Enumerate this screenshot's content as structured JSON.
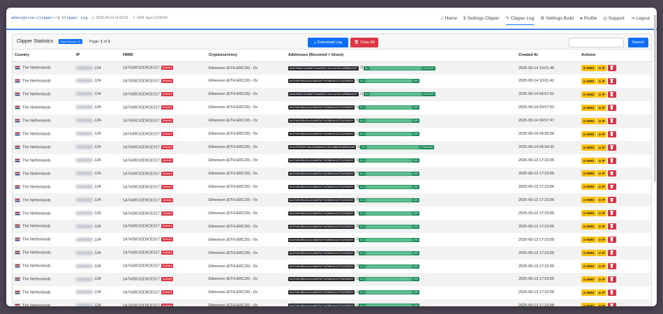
{
  "topbar": {
    "term_user": "admin@crow-clipper",
    "term_sep": ":~$",
    "term_page": "Clipper Log",
    "datetime": "2026-09-14 11:00:21",
    "uptime": "1941 days 12:00:00"
  },
  "nav": {
    "items": [
      {
        "label": "Home",
        "icon": "home-icon"
      },
      {
        "label": "Settings Clipper",
        "icon": "dollar-icon"
      },
      {
        "label": "Clipper Log",
        "icon": "pencil-icon",
        "active": true
      },
      {
        "label": "Settings Build",
        "icon": "gear-icon"
      },
      {
        "label": "Profile",
        "icon": "user-icon"
      },
      {
        "label": "Support",
        "icon": "support-icon"
      },
      {
        "label": "Logout",
        "icon": "logout-icon"
      }
    ]
  },
  "header": {
    "title": "Clipper Statistics",
    "total_badge": "Total Records: 32",
    "page_prefix": "Page:",
    "page_current": "1",
    "page_of": "of",
    "page_total": "1",
    "download_label": "Download Log",
    "clear_label": "Clear All",
    "search_placeholder": "",
    "search_label": "Search"
  },
  "table": {
    "columns": [
      "Country",
      "IP",
      "HWID",
      "Cryptocurrency",
      "Addresses (Received > Given)",
      "Created At",
      "Actions"
    ],
    "deleted_label": "Deleted",
    "hwid_btn": "HWID",
    "ip_btn": "IP",
    "rows": [
      {
        "country": "The Netherlands",
        "ip": ".124",
        "hwid": "1A7439C02D9CE017",
        "crypto": "Ethereum (ETH.ERC20) - 0x",
        "recv": "0x0165a8f41b58dff1be0507c7ee1cdf4e1a9988d4137",
        "given_a": "0x",
        "given_b": "e20a137",
        "created": "2025-09-14 10:01:45"
      },
      {
        "country": "The Netherlands",
        "ip": ".124",
        "hwid": "1A7439C02D9CE017",
        "crypto": "Ethereum (ETH.ERC20) - 0x",
        "recv": "0x2fe9c38b15ca14d847bf7e530b3e147334238495",
        "given_a": "0x",
        "given_b": "495",
        "created": "2025-09-14 10:01:41"
      },
      {
        "country": "The Netherlands",
        "ip": ".124",
        "hwid": "1A7439C02D9CE017",
        "crypto": "Ethereum (ETH.ERC20) - 0x",
        "recv": "0x0165a8f41b58dff1be0507c7ee1cdf4e1a9988d4137",
        "given_a": "0x",
        "given_b": "e20a137",
        "created": "2025-09-14 09:57:52"
      },
      {
        "country": "The Netherlands",
        "ip": ".124",
        "hwid": "1A7439C02D9CE017",
        "crypto": "Ethereum (ETH.ERC20) - 0x",
        "recv": "0x2fe9c38b15ca14d847bf7e530b3e147334238495",
        "given_a": "0x",
        "given_b": "495",
        "created": "2025-09-14 09:57:52"
      },
      {
        "country": "The Netherlands",
        "ip": ".124",
        "hwid": "1A7439C02D9CE017",
        "crypto": "Ethereum (ETH.ERC20) - 0x",
        "recv": "0x2fe9c38b15ca14d847bf7e530b3e147334238495",
        "given_a": "0x",
        "given_b": "495",
        "created": "2025-09-14 09:57:47"
      },
      {
        "country": "The Netherlands",
        "ip": ".124",
        "hwid": "1A7439C02D9CE017",
        "crypto": "Ethereum (ETH.ERC20) - 0x",
        "recv": "0x2fe9c38b15ca14d847bf7e530b3e147334238495",
        "given_a": "0x",
        "given_b": "495",
        "created": "2025-09-14 09:55:06"
      },
      {
        "country": "The Netherlands",
        "ip": ".124",
        "hwid": "1A7439C02D9CE017",
        "crypto": "Ethereum (ETH.ERC20) - 0x",
        "recv": "0x4478349071d0c83d0dd6aC378fd888f820563deb8",
        "given_a": "0x",
        "given_b": "7f20deb8",
        "created": "2025-09-14 06:34:32"
      },
      {
        "country": "The Netherlands",
        "ip": ".124",
        "hwid": "1A7439C02D9CE017",
        "crypto": "Ethereum (ETH.ERC20) - 0x",
        "recv": "0x2fe9c38b15ca14d847bf7e530b3e147334238495",
        "given_a": "0x",
        "given_b": "495",
        "created": "2025-09-13 17:23:06"
      },
      {
        "country": "The Netherlands",
        "ip": ".124",
        "hwid": "1A7439C02D9CE017",
        "crypto": "Ethereum (ETH.ERC20) - 0x",
        "recv": "0x2fe9c38b15ca14d847bf7e530b3e147334238495",
        "given_a": "0x",
        "given_b": "495",
        "created": "2025-09-13 17:23:06"
      },
      {
        "country": "The Netherlands",
        "ip": ".124",
        "hwid": "1A7439C02D9CE017",
        "crypto": "Ethereum (ETH.ERC20) - 0x",
        "recv": "0x2fe9c38b15ca14d847bf7e530b3e147334238495",
        "given_a": "0x",
        "given_b": "495",
        "created": "2025-09-13 17:23:06"
      },
      {
        "country": "The Netherlands",
        "ip": ".124",
        "hwid": "1A7439C02D9CE017",
        "crypto": "Ethereum (ETH.ERC20) - 0x",
        "recv": "0x2fe9c38b15ca14d847bf7e530b3e147334238495",
        "given_a": "0x",
        "given_b": "495",
        "created": "2025-09-13 17:23:06"
      },
      {
        "country": "The Netherlands",
        "ip": ".124",
        "hwid": "1A7439C02D9CE017",
        "crypto": "Ethereum (ETH.ERC20) - 0x",
        "recv": "0x2fe9c38b15ca14d847bf7e530b3e147334238495",
        "given_a": "0x",
        "given_b": "495",
        "created": "2025-09-13 17:23:06"
      },
      {
        "country": "The Netherlands",
        "ip": ".124",
        "hwid": "1A7439C02D9CE017",
        "crypto": "Ethereum (ETH.ERC20) - 0x",
        "recv": "0x2fe9c38b15ca14d847bf7e530b3e147334238495",
        "given_a": "0x",
        "given_b": "495",
        "created": "2025-09-13 17:23:06"
      },
      {
        "country": "The Netherlands",
        "ip": ".124",
        "hwid": "1A7439C02D9CE017",
        "crypto": "Ethereum (ETH.ERC20) - 0x",
        "recv": "0x2fe9c38b15ca14d847bf7e530b3e147334238495",
        "given_a": "0x",
        "given_b": "495",
        "created": "2025-09-13 17:23:05"
      },
      {
        "country": "The Netherlands",
        "ip": ".124",
        "hwid": "1A7439C02D9CE017",
        "crypto": "Ethereum (ETH.ERC20) - 0x",
        "recv": "0x2fe9c38b15ca14d847bf7e530b3e147334238495",
        "given_a": "0x",
        "given_b": "495",
        "created": "2025-09-13 17:23:05"
      },
      {
        "country": "The Netherlands",
        "ip": ".124",
        "hwid": "1A7439C02D9CE017",
        "crypto": "Ethereum (ETH.ERC20) - 0x",
        "recv": "0x2fe9c38b15ca14d847bf7e530b3e147334238495",
        "given_a": "0x",
        "given_b": "495",
        "created": "2025-09-13 17:23:05"
      },
      {
        "country": "The Netherlands",
        "ip": ".124",
        "hwid": "1A7439C02D9CE017",
        "crypto": "Ethereum (ETH.ERC20) - 0x",
        "recv": "0x2fe9c38b15ca14d847bf7e530b3e147334238495",
        "given_a": "0x",
        "given_b": "495",
        "created": "2025-09-13 17:23:05"
      },
      {
        "country": "The Netherlands",
        "ip": ".124",
        "hwid": "1A7439C02D9CE017",
        "crypto": "Ethereum (ETH.ERC20) - 0x",
        "recv": "0x2fe9c38b15ca14d847bf7e530b3e147334238495",
        "given_a": "0x",
        "given_b": "495",
        "created": "2025-09-13 17:22:58"
      },
      {
        "country": "The Netherlands",
        "ip": ".124",
        "hwid": "1A7439C02D9CE017",
        "crypto": "Ethereum (ETH.ERC20) - 0x",
        "recv": "0x2fe9c38b15ca14d847bf7e530b3e147334238495",
        "given_a": "0x",
        "given_b": "495",
        "created": "2025-09-13 17:22:58"
      }
    ]
  }
}
